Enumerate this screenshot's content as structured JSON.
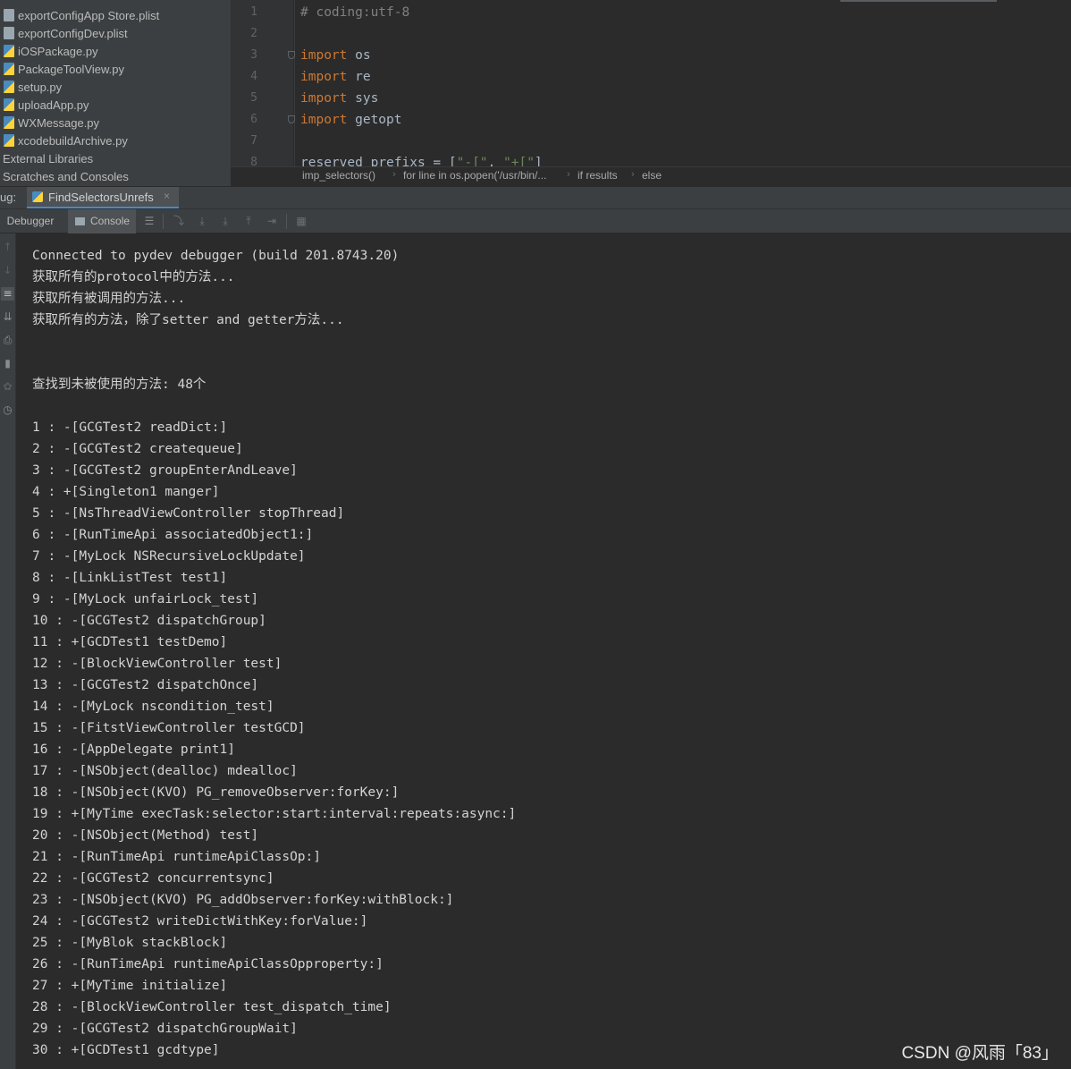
{
  "project_tree": {
    "items": [
      {
        "label": "exportConfigApp Store.plist",
        "type": "plist"
      },
      {
        "label": "exportConfigDev.plist",
        "type": "plist"
      },
      {
        "label": "iOSPackage.py",
        "type": "py"
      },
      {
        "label": "PackageToolView.py",
        "type": "py"
      },
      {
        "label": "setup.py",
        "type": "py"
      },
      {
        "label": "uploadApp.py",
        "type": "py"
      },
      {
        "label": "WXMessage.py",
        "type": "py"
      },
      {
        "label": "xcodebuildArchive.py",
        "type": "py"
      }
    ],
    "external_libraries": "External Libraries",
    "scratches": "Scratches and Consoles"
  },
  "editor": {
    "line_numbers": [
      "1",
      "2",
      "3",
      "4",
      "5",
      "6",
      "7",
      "8"
    ],
    "lines": [
      {
        "parts": [
          {
            "t": "# coding:utf-8",
            "c": "cm"
          }
        ]
      },
      {
        "parts": []
      },
      {
        "parts": [
          {
            "t": "import",
            "c": "kw"
          },
          {
            "t": " os",
            "c": ""
          }
        ]
      },
      {
        "parts": [
          {
            "t": "import",
            "c": "kw"
          },
          {
            "t": " re",
            "c": ""
          }
        ]
      },
      {
        "parts": [
          {
            "t": "import",
            "c": "kw"
          },
          {
            "t": " sys",
            "c": ""
          }
        ]
      },
      {
        "parts": [
          {
            "t": "import",
            "c": "kw"
          },
          {
            "t": " getopt",
            "c": ""
          }
        ]
      },
      {
        "parts": []
      },
      {
        "parts": [
          {
            "t": "reserved_prefixs = [",
            "c": ""
          },
          {
            "t": "\"-[\"",
            "c": "st"
          },
          {
            "t": ", ",
            "c": ""
          },
          {
            "t": "\"+[\"",
            "c": "st"
          },
          {
            "t": "]",
            "c": ""
          }
        ]
      }
    ]
  },
  "breadcrumb": [
    "imp_selectors()",
    "for line in os.popen('/usr/bin/...",
    "if results",
    "else"
  ],
  "debug_bar": {
    "prefix": "ug:",
    "run_tab": "FindSelectorsUnrefs",
    "close": "×"
  },
  "toolbar": {
    "debugger": "Debugger",
    "console": "Console"
  },
  "console_lines": [
    "Connected to pydev debugger (build 201.8743.20)",
    "获取所有的protocol中的方法...",
    "获取所有被调用的方法...",
    "获取所有的方法，除了setter and getter方法...",
    "",
    "",
    "查找到未被使用的方法: 48个",
    "",
    "1 : -[GCGTest2 readDict:]",
    "2 : -[GCGTest2 createqueue]",
    "3 : -[GCGTest2 groupEnterAndLeave]",
    "4 : +[Singleton1 manger]",
    "5 : -[NsThreadViewController stopThread]",
    "6 : -[RunTimeApi associatedObject1:]",
    "7 : -[MyLock NSRecursiveLockUpdate]",
    "8 : -[LinkListTest test1]",
    "9 : -[MyLock unfairLock_test]",
    "10 : -[GCGTest2 dispatchGroup]",
    "11 : +[GCDTest1 testDemo]",
    "12 : -[BlockViewController test]",
    "13 : -[GCGTest2 dispatchOnce]",
    "14 : -[MyLock nscondition_test]",
    "15 : -[FitstViewController testGCD]",
    "16 : -[AppDelegate print1]",
    "17 : -[NSObject(dealloc) mdealloc]",
    "18 : -[NSObject(KVO) PG_removeObserver:forKey:]",
    "19 : +[MyTime execTask:selector:start:interval:repeats:async:]",
    "20 : -[NSObject(Method) test]",
    "21 : -[RunTimeApi runtimeApiClassOp:]",
    "22 : -[GCGTest2 concurrentsync]",
    "23 : -[NSObject(KVO) PG_addObserver:forKey:withBlock:]",
    "24 : -[GCGTest2 writeDictWithKey:forValue:]",
    "25 : -[MyBlok stackBlock]",
    "26 : -[RunTimeApi runtimeApiClassOpproperty:]",
    "27 : +[MyTime initialize]",
    "28 : -[BlockViewController test_dispatch_time]",
    "29 : -[GCGTest2 dispatchGroupWait]",
    "30 : +[GCDTest1 gcdtype]"
  ],
  "watermark": "CSDN @风雨「83」"
}
